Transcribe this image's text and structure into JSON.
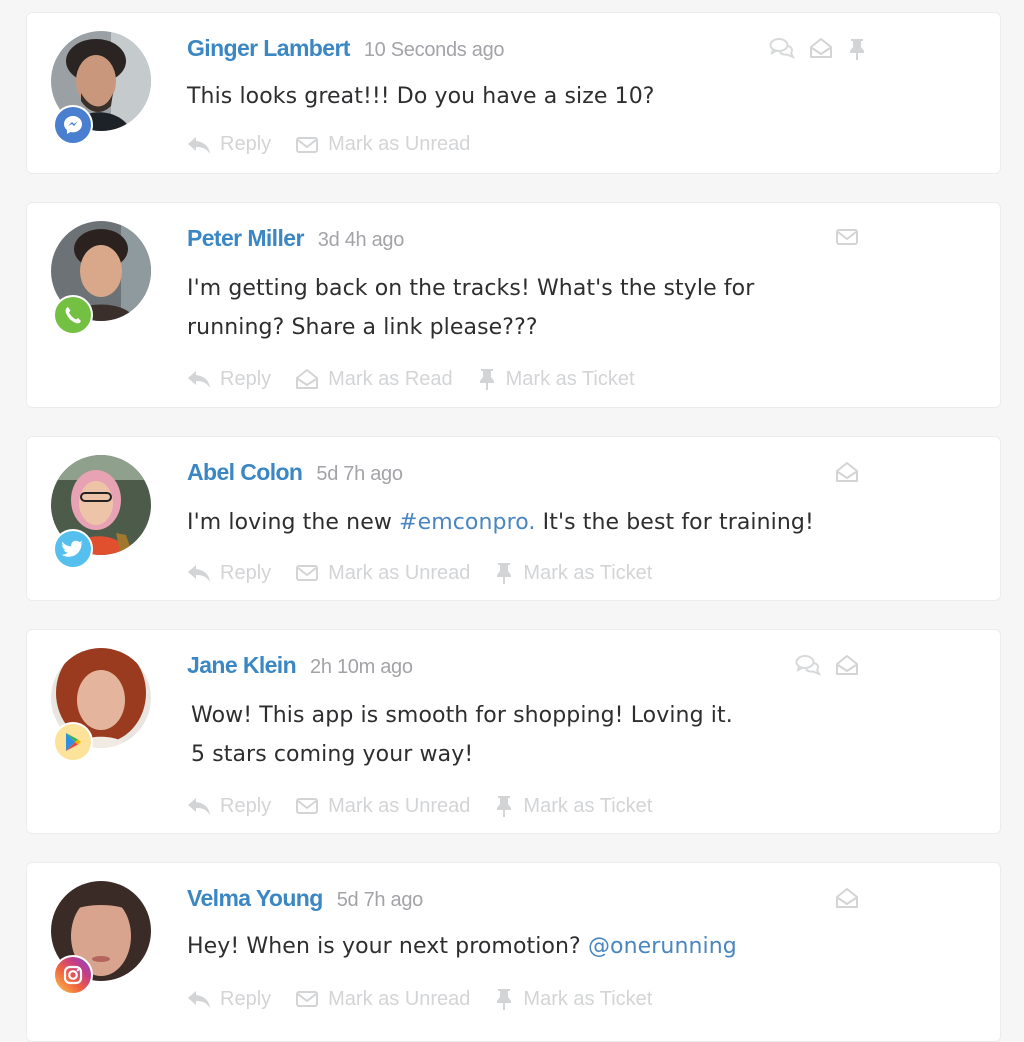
{
  "labels": {
    "reply": "Reply",
    "mark_unread": "Mark as Unread",
    "mark_read": "Mark as Read",
    "mark_ticket": "Mark as Ticket"
  },
  "colors": {
    "name": "#3b87c4",
    "link": "#4a86bf",
    "messenger": "#4a7fd0",
    "whatsapp": "#74c043",
    "twitter": "#55c0ee",
    "google_play": "#fde29a"
  },
  "messages": [
    {
      "name": "Ginger Lambert",
      "time": "10 Seconds ago",
      "platform": "messenger-icon",
      "text_parts": [
        "This looks great!!! Do you have a size 10?"
      ],
      "actions": [
        "Reply",
        "Mark as Unread"
      ],
      "top_icons": [
        "chat-bubbles-icon",
        "envelope-open-icon",
        "pin-icon"
      ]
    },
    {
      "name": "Peter Miller",
      "time": "3d 4h ago",
      "platform": "whatsapp-icon",
      "text_parts": [
        "I'm getting back on the tracks! What's the style for",
        "running? Share a link please???"
      ],
      "actions": [
        "Reply",
        "Mark as Read",
        "Mark as Ticket"
      ],
      "top_icons": [
        "envelope-icon"
      ]
    },
    {
      "name": "Abel Colon",
      "time": "5d 7h ago",
      "platform": "twitter-icon",
      "text_before": "I'm loving the new ",
      "hashtag": "#emconpro.",
      "text_after": " It's the best for training!",
      "actions": [
        "Reply",
        "Mark as Unread",
        "Mark as Ticket"
      ],
      "top_icons": [
        "envelope-open-icon"
      ]
    },
    {
      "name": "Jane Klein",
      "time": "2h 10m ago",
      "platform": "google-play-icon",
      "text_parts": [
        "Wow! This app is smooth for shopping! Loving it.",
        "5 stars coming your way!"
      ],
      "actions": [
        "Reply",
        "Mark as Unread",
        "Mark as Ticket"
      ],
      "top_icons": [
        "chat-bubbles-icon",
        "envelope-open-icon"
      ]
    },
    {
      "name": "Velma Young",
      "time": "5d 7h ago",
      "platform": "instagram-icon",
      "text_before": "Hey! When is your next promotion? ",
      "mention": "@onerunning",
      "actions": [
        "Reply",
        "Mark as Unread",
        "Mark as Ticket"
      ],
      "top_icons": [
        "envelope-open-icon"
      ]
    }
  ]
}
